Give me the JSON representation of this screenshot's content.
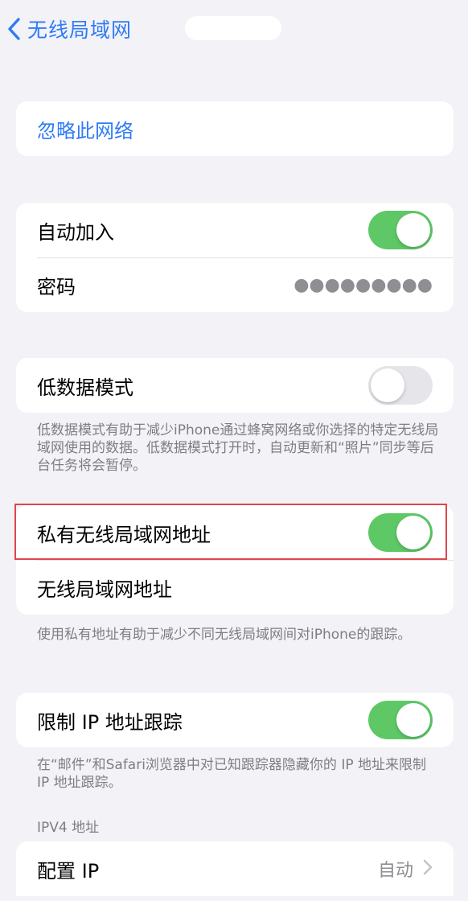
{
  "nav": {
    "back_label": "无线局域网"
  },
  "forget": {
    "label": "忽略此网络"
  },
  "join": {
    "auto_join_label": "自动加入",
    "auto_join_on": true,
    "password_label": "密码",
    "password_mask": "●●●●●●●●●"
  },
  "low_data": {
    "label": "低数据模式",
    "enabled": false,
    "footnote": "低数据模式有助于减少iPhone通过蜂窝网络或你选择的特定无线局域网使用的数据。低数据模式打开时，自动更新和“照片”同步等后台任务将会暂停。"
  },
  "private_address": {
    "label": "私有无线局域网地址",
    "enabled": true,
    "address_label": "无线局域网地址",
    "footnote": "使用私有地址有助于减少不同无线局域网间对iPhone的跟踪。"
  },
  "limit_tracking": {
    "label": "限制 IP 地址跟踪",
    "enabled": true,
    "footnote": "在“邮件”和Safari浏览器中对已知跟踪器隐藏你的 IP 地址来限制 IP 地址跟踪。"
  },
  "ipv4": {
    "header": "IPV4 地址",
    "configure_label": "配置 IP",
    "configure_value": "自动"
  },
  "colors": {
    "accent": "#2f7bf6",
    "toggle_on": "#5ec866",
    "highlight": "#e0454b"
  },
  "icons": {
    "back": "chevron-left-icon",
    "disclosure": "chevron-right-icon"
  }
}
